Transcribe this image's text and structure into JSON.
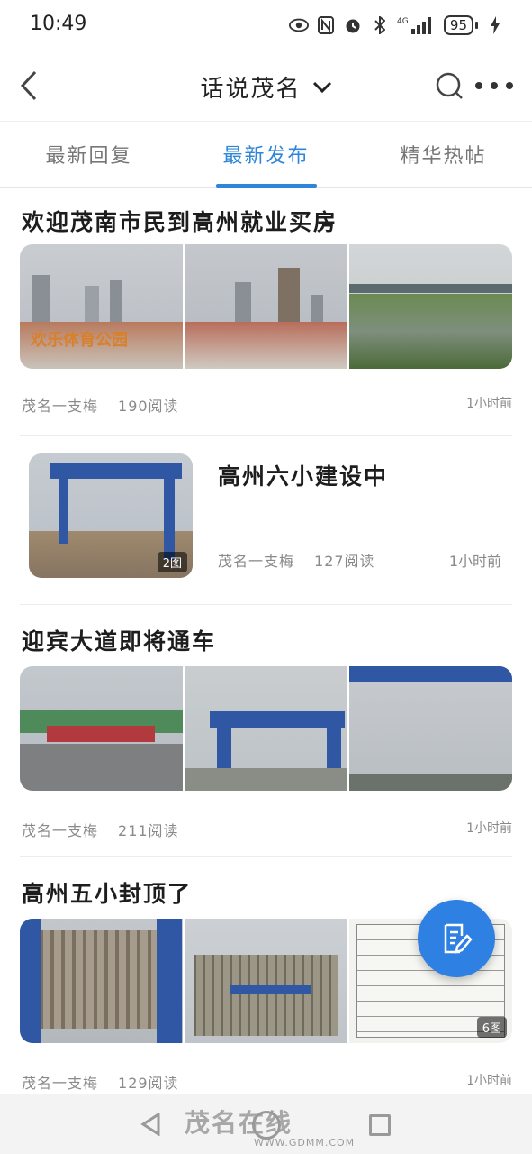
{
  "status_bar": {
    "time": "10:49",
    "network": "4G",
    "battery": "95"
  },
  "header": {
    "title": "话说茂名"
  },
  "tabs": [
    {
      "label": "最新回复",
      "active": false
    },
    {
      "label": "最新发布",
      "active": true
    },
    {
      "label": "精华热帖",
      "active": false
    }
  ],
  "posts": [
    {
      "title": "欢迎茂南市民到高州就业买房",
      "author": "茂名一支梅",
      "reads": "190阅读",
      "time": "1小时前"
    },
    {
      "title": "高州六小建设中",
      "author": "茂名一支梅",
      "reads": "127阅读",
      "time": "1小时前",
      "image_count": "2图"
    },
    {
      "title": "迎宾大道即将通车",
      "author": "茂名一支梅",
      "reads": "211阅读",
      "time": "1小时前"
    },
    {
      "title": "高州五小封顶了",
      "author": "茂名一支梅",
      "reads": "129阅读",
      "time": "1小时前",
      "image_count": "6图"
    }
  ],
  "watermark": {
    "brand": "茂名在线",
    "url": "WWW.GDMM.COM"
  },
  "colors": {
    "accent": "#2e86d9",
    "fab": "#2f80e3"
  },
  "icons": [
    "back-icon",
    "chevron-down-icon",
    "search-icon",
    "more-icon",
    "compose-icon"
  ]
}
